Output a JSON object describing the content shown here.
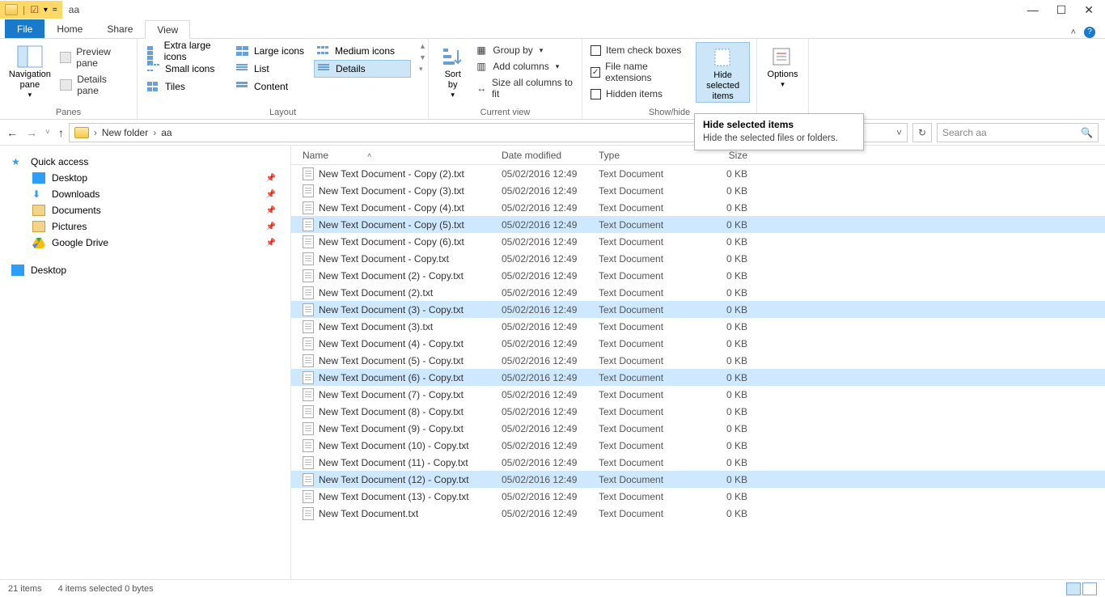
{
  "window": {
    "title": "aa"
  },
  "tabs": {
    "file": "File",
    "home": "Home",
    "share": "Share",
    "view": "View"
  },
  "ribbon": {
    "panes": {
      "nav": "Navigation\npane",
      "preview": "Preview pane",
      "details": "Details pane",
      "group": "Panes"
    },
    "layout": {
      "extra_large": "Extra large icons",
      "large": "Large icons",
      "medium": "Medium icons",
      "small": "Small icons",
      "list": "List",
      "details": "Details",
      "tiles": "Tiles",
      "content": "Content",
      "group": "Layout"
    },
    "current": {
      "sort": "Sort\nby",
      "group_by": "Group by",
      "add_cols": "Add columns",
      "size_cols": "Size all columns to fit",
      "group": "Current view"
    },
    "showhide": {
      "item_check": "Item check boxes",
      "file_ext": "File name extensions",
      "hidden": "Hidden items",
      "hide_sel": "Hide selected\nitems",
      "group": "Show/hide"
    },
    "options": {
      "label": "Options"
    }
  },
  "tooltip": {
    "title": "Hide selected items",
    "body": "Hide the selected files or folders."
  },
  "breadcrumb": {
    "seg1": "New folder",
    "seg2": "aa"
  },
  "search": {
    "placeholder": "Search aa"
  },
  "sidebar": {
    "quick": "Quick access",
    "desktop": "Desktop",
    "downloads": "Downloads",
    "documents": "Documents",
    "pictures": "Pictures",
    "gdrive": "Google Drive",
    "desktop2": "Desktop"
  },
  "columns": {
    "name": "Name",
    "date": "Date modified",
    "type": "Type",
    "size": "Size"
  },
  "files": [
    {
      "name": "New Text Document - Copy (2).txt",
      "date": "05/02/2016 12:49",
      "type": "Text Document",
      "size": "0 KB",
      "sel": false
    },
    {
      "name": "New Text Document - Copy (3).txt",
      "date": "05/02/2016 12:49",
      "type": "Text Document",
      "size": "0 KB",
      "sel": false
    },
    {
      "name": "New Text Document - Copy (4).txt",
      "date": "05/02/2016 12:49",
      "type": "Text Document",
      "size": "0 KB",
      "sel": false
    },
    {
      "name": "New Text Document - Copy (5).txt",
      "date": "05/02/2016 12:49",
      "type": "Text Document",
      "size": "0 KB",
      "sel": true
    },
    {
      "name": "New Text Document - Copy (6).txt",
      "date": "05/02/2016 12:49",
      "type": "Text Document",
      "size": "0 KB",
      "sel": false
    },
    {
      "name": "New Text Document - Copy.txt",
      "date": "05/02/2016 12:49",
      "type": "Text Document",
      "size": "0 KB",
      "sel": false
    },
    {
      "name": "New Text Document (2) - Copy.txt",
      "date": "05/02/2016 12:49",
      "type": "Text Document",
      "size": "0 KB",
      "sel": false
    },
    {
      "name": "New Text Document (2).txt",
      "date": "05/02/2016 12:49",
      "type": "Text Document",
      "size": "0 KB",
      "sel": false
    },
    {
      "name": "New Text Document (3) - Copy.txt",
      "date": "05/02/2016 12:49",
      "type": "Text Document",
      "size": "0 KB",
      "sel": true
    },
    {
      "name": "New Text Document (3).txt",
      "date": "05/02/2016 12:49",
      "type": "Text Document",
      "size": "0 KB",
      "sel": false
    },
    {
      "name": "New Text Document (4) - Copy.txt",
      "date": "05/02/2016 12:49",
      "type": "Text Document",
      "size": "0 KB",
      "sel": false
    },
    {
      "name": "New Text Document (5) - Copy.txt",
      "date": "05/02/2016 12:49",
      "type": "Text Document",
      "size": "0 KB",
      "sel": false
    },
    {
      "name": "New Text Document (6) - Copy.txt",
      "date": "05/02/2016 12:49",
      "type": "Text Document",
      "size": "0 KB",
      "sel": true
    },
    {
      "name": "New Text Document (7) - Copy.txt",
      "date": "05/02/2016 12:49",
      "type": "Text Document",
      "size": "0 KB",
      "sel": false
    },
    {
      "name": "New Text Document (8) - Copy.txt",
      "date": "05/02/2016 12:49",
      "type": "Text Document",
      "size": "0 KB",
      "sel": false
    },
    {
      "name": "New Text Document (9) - Copy.txt",
      "date": "05/02/2016 12:49",
      "type": "Text Document",
      "size": "0 KB",
      "sel": false
    },
    {
      "name": "New Text Document (10) - Copy.txt",
      "date": "05/02/2016 12:49",
      "type": "Text Document",
      "size": "0 KB",
      "sel": false
    },
    {
      "name": "New Text Document (11) - Copy.txt",
      "date": "05/02/2016 12:49",
      "type": "Text Document",
      "size": "0 KB",
      "sel": false
    },
    {
      "name": "New Text Document (12) - Copy.txt",
      "date": "05/02/2016 12:49",
      "type": "Text Document",
      "size": "0 KB",
      "sel": true
    },
    {
      "name": "New Text Document (13) - Copy.txt",
      "date": "05/02/2016 12:49",
      "type": "Text Document",
      "size": "0 KB",
      "sel": false
    },
    {
      "name": "New Text Document.txt",
      "date": "05/02/2016 12:49",
      "type": "Text Document",
      "size": "0 KB",
      "sel": false
    }
  ],
  "status": {
    "count": "21 items",
    "selected": "4 items selected  0 bytes"
  }
}
